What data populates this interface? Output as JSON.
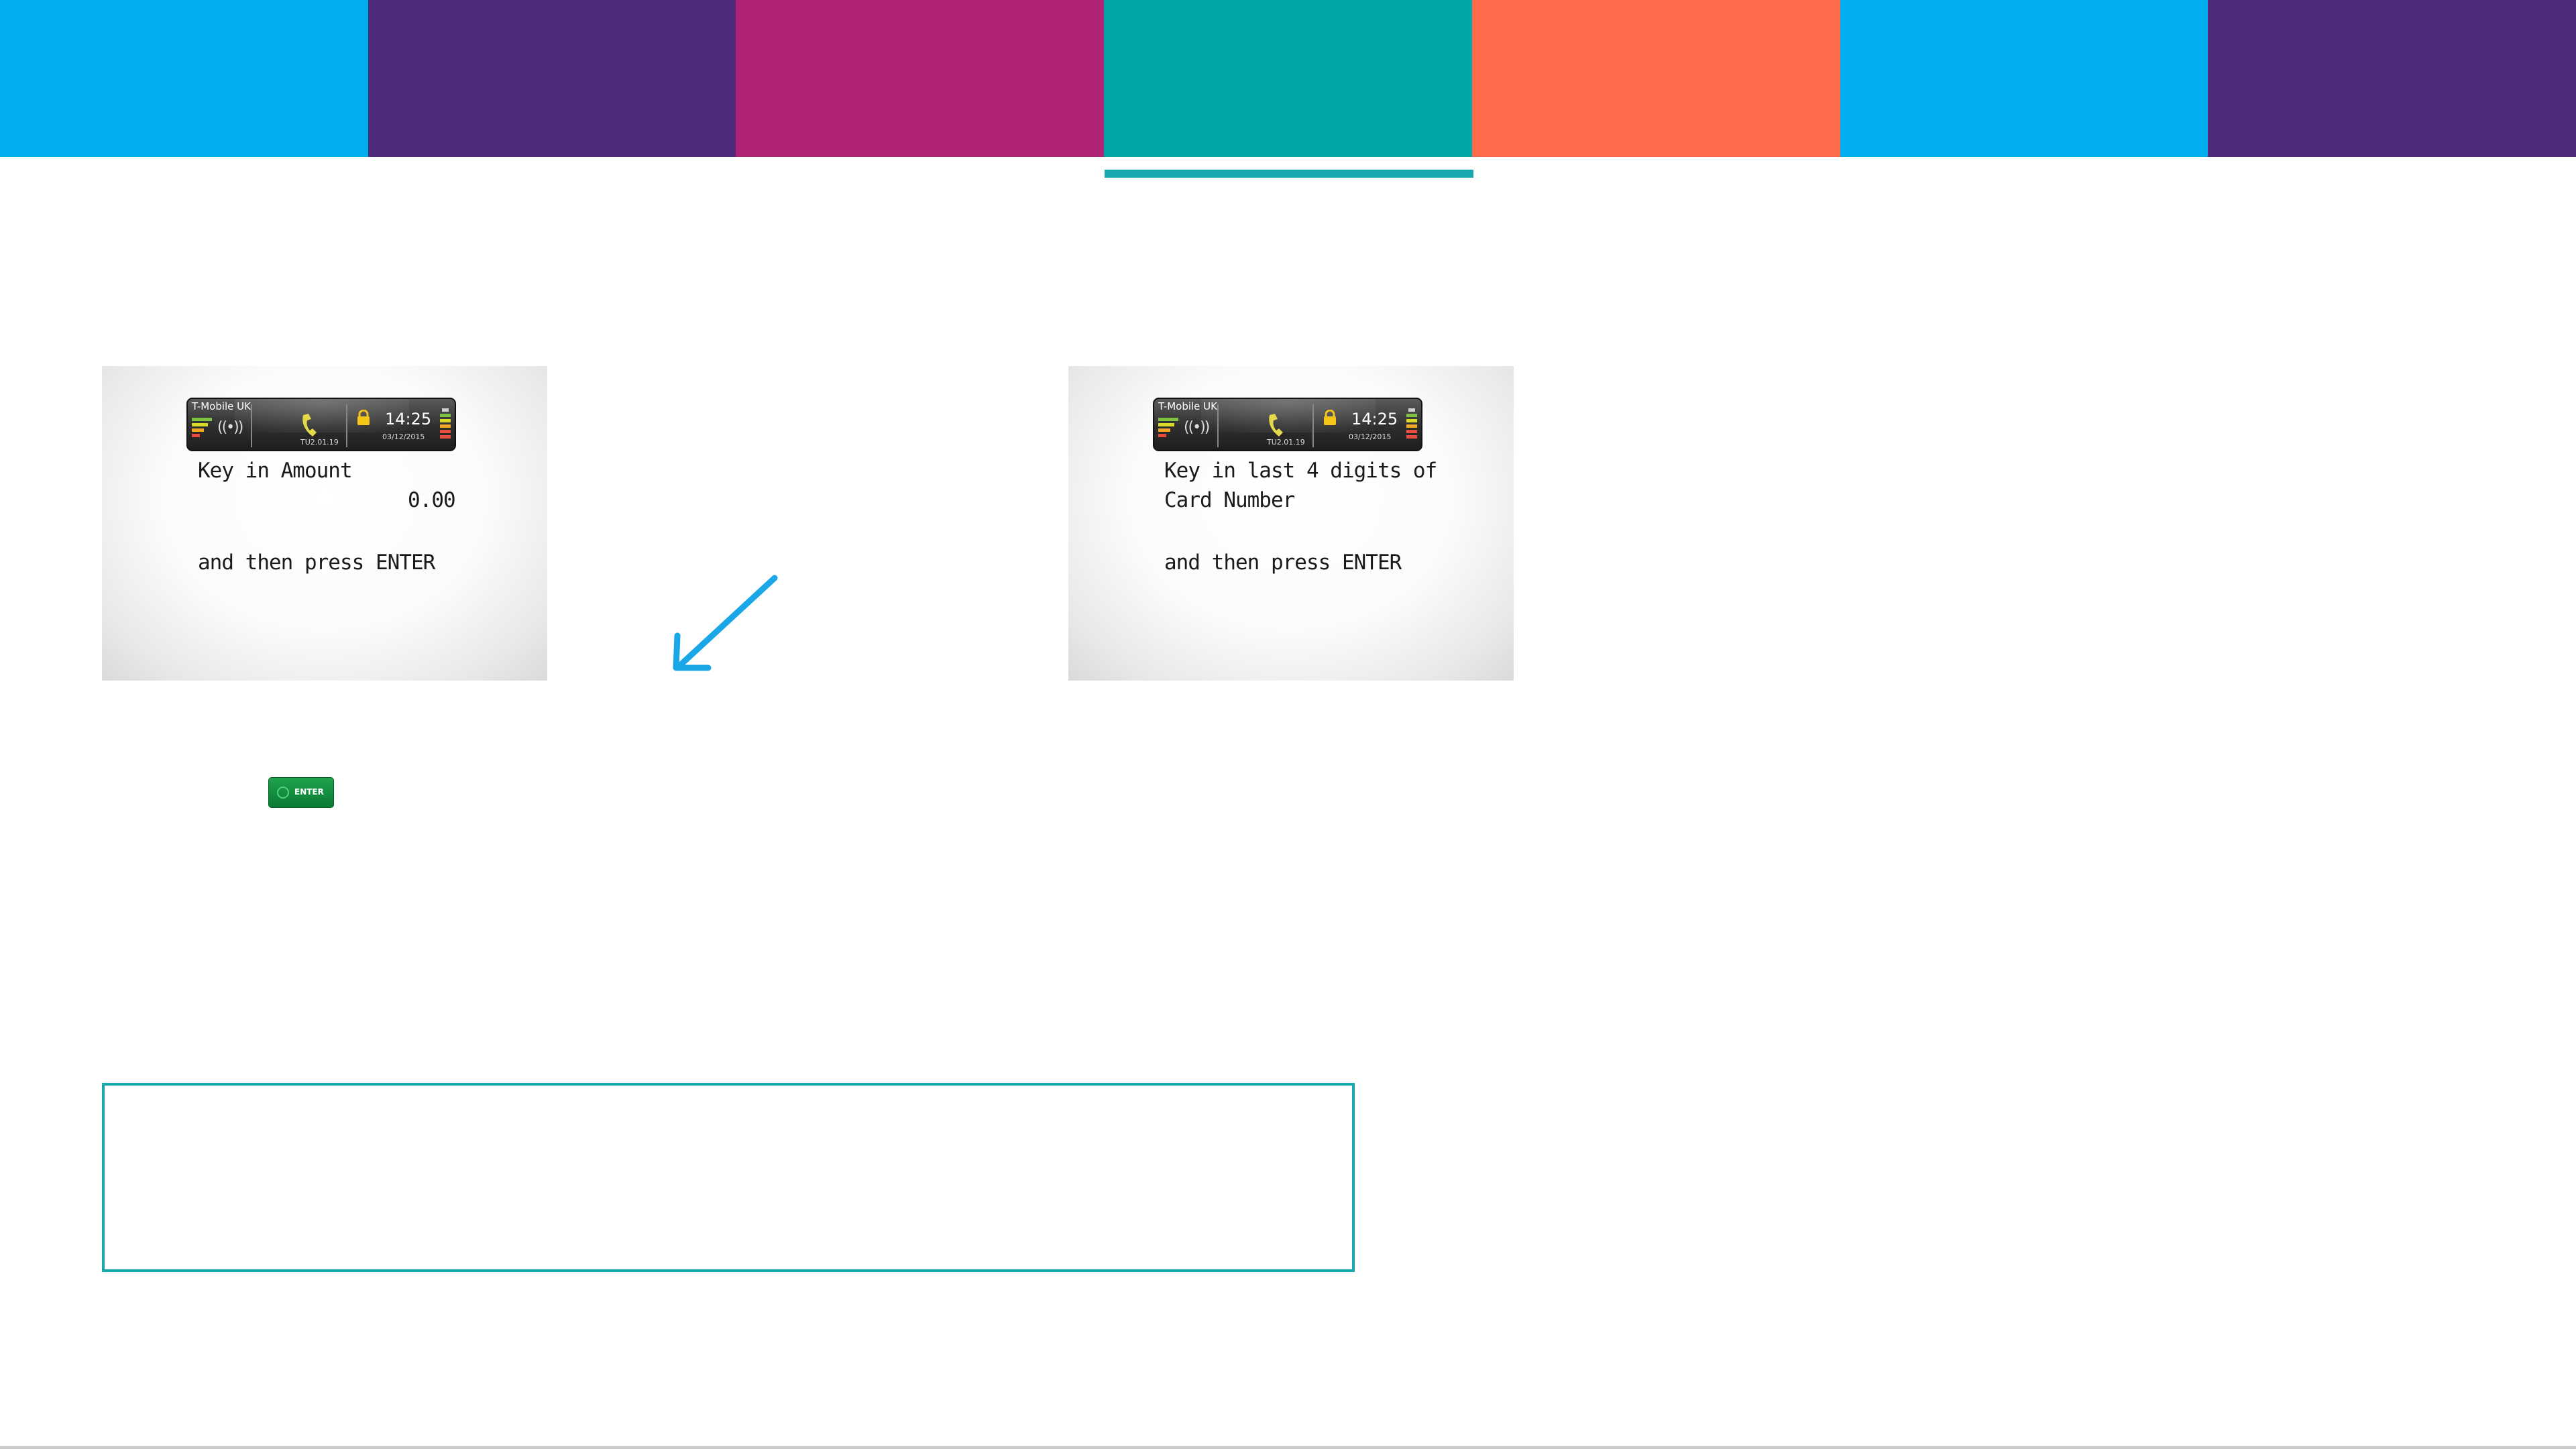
{
  "nav": {
    "tabs": [
      {
        "color": "#00aeef"
      },
      {
        "color": "#4e2a7d"
      },
      {
        "color": "#b02374"
      },
      {
        "color": "#00a5a5",
        "active": true
      },
      {
        "color": "#ff6b4a"
      },
      {
        "color": "#00aeef"
      },
      {
        "color": "#4e2a7d"
      }
    ],
    "active_underline_color": "#18a8ad"
  },
  "terminals": [
    {
      "status": {
        "carrier": "T-Mobile UK",
        "terminal_id": "TU2.01.19",
        "time": "14:25",
        "date": "03/12/2015"
      },
      "lines": [
        "Key in Amount",
        "0.00",
        "and then press ENTER"
      ]
    },
    {
      "status": {
        "carrier": "T-Mobile UK",
        "terminal_id": "TU2.01.19",
        "time": "14:25",
        "date": "03/12/2015"
      },
      "lines": [
        "Key in last 4 digits of",
        "Card Number",
        "and then press ENTER"
      ]
    }
  ],
  "enter_key": {
    "label": "ENTER"
  },
  "colors": {
    "arrow": "#1aa7e8",
    "enter_key": "#0f8a3a",
    "note_border": "#18a8ad"
  },
  "icons": [
    "signal-bars-icon",
    "contactless-icon",
    "phone-icon",
    "lock-icon",
    "battery-icon",
    "arrow-down-left-icon"
  ]
}
